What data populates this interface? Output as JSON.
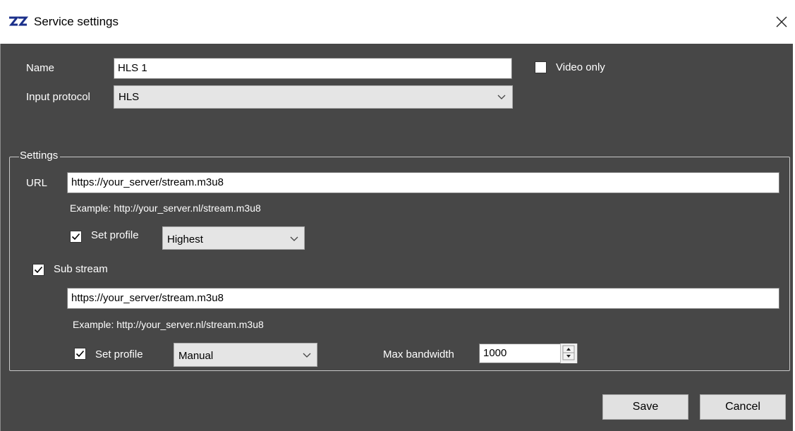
{
  "window": {
    "title": "Service settings",
    "close_label": "×"
  },
  "general": {
    "name_label": "Name",
    "name_value": "HLS 1",
    "video_only_label": "Video only",
    "video_only_checked": false,
    "input_protocol_label": "Input protocol",
    "input_protocol_value": "HLS"
  },
  "settings": {
    "group_label": "Settings",
    "url_label": "URL",
    "url_value": "https://your_server/stream.m3u8",
    "url_example": "Example: http://your_server.nl/stream.m3u8",
    "set_profile_label": "Set profile",
    "set_profile_checked": true,
    "profile_value": "Highest",
    "sub_stream_label": "Sub stream",
    "sub_stream_checked": true,
    "sub_url_value": "https://your_server/stream.m3u8",
    "sub_url_example": "Example: http://your_server.nl/stream.m3u8",
    "sub_set_profile_label": "Set profile",
    "sub_set_profile_checked": true,
    "sub_profile_value": "Manual",
    "max_bandwidth_label": "Max bandwidth",
    "max_bandwidth_value": "1000"
  },
  "actions": {
    "save_label": "Save",
    "cancel_label": "Cancel"
  },
  "colors": {
    "dialog_background": "#474747",
    "field_background": "#ffffff",
    "combo_background": "#e5e5e5",
    "button_background": "#e1e1e1",
    "label_text": "#ffffff"
  },
  "icons": {
    "app": "app-logo-icon",
    "close": "close-icon",
    "dropdown": "chevron-down-icon",
    "check": "checkmark-icon",
    "spin": "spin-arrows-icon"
  }
}
